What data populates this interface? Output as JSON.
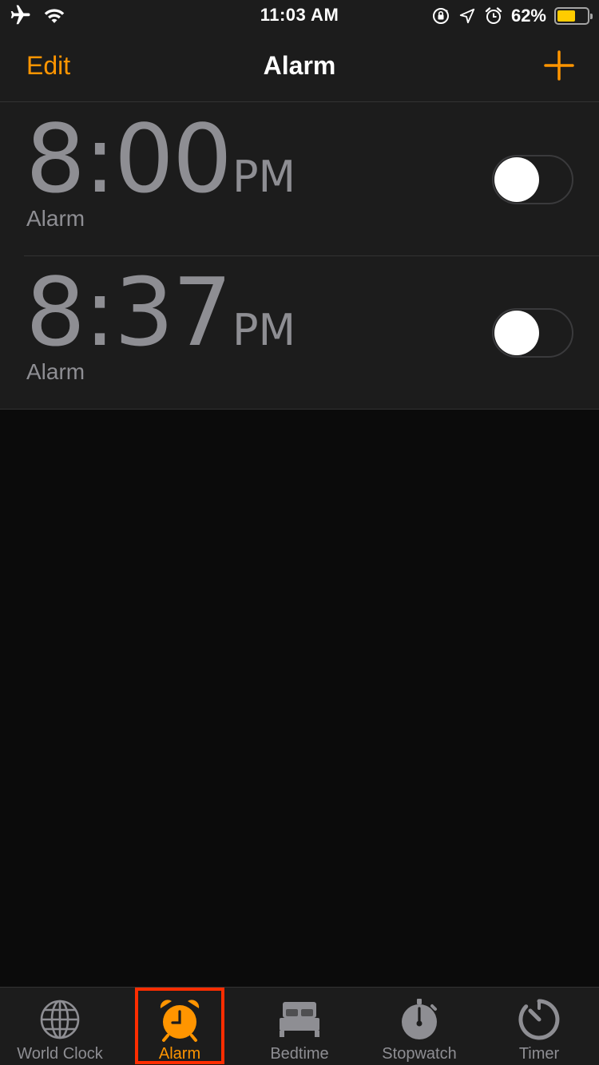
{
  "status_bar": {
    "time": "11:03 AM",
    "battery_percent": "62%",
    "battery_level": 0.62,
    "icons": [
      "airplane-icon",
      "wifi-icon",
      "orientation-lock-icon",
      "location-icon",
      "alarm-status-icon",
      "battery-icon"
    ]
  },
  "nav": {
    "edit_label": "Edit",
    "title": "Alarm",
    "add_icon": "plus-icon"
  },
  "alarms": [
    {
      "time": "8:00",
      "ampm": "PM",
      "label": "Alarm",
      "enabled": false
    },
    {
      "time": "8:37",
      "ampm": "PM",
      "label": "Alarm",
      "enabled": false
    }
  ],
  "tabs": [
    {
      "label": "World Clock",
      "icon": "globe-icon",
      "active": false
    },
    {
      "label": "Alarm",
      "icon": "alarm-clock-icon",
      "active": true
    },
    {
      "label": "Bedtime",
      "icon": "bed-icon",
      "active": false
    },
    {
      "label": "Stopwatch",
      "icon": "stopwatch-icon",
      "active": false
    },
    {
      "label": "Timer",
      "icon": "timer-icon",
      "active": false
    }
  ],
  "colors": {
    "accent": "#ff9500",
    "inactive": "#8e8e93",
    "background": "#0b0b0b",
    "bar": "#1c1c1c",
    "highlight": "#ff2d00",
    "battery": "#ffcc00"
  }
}
